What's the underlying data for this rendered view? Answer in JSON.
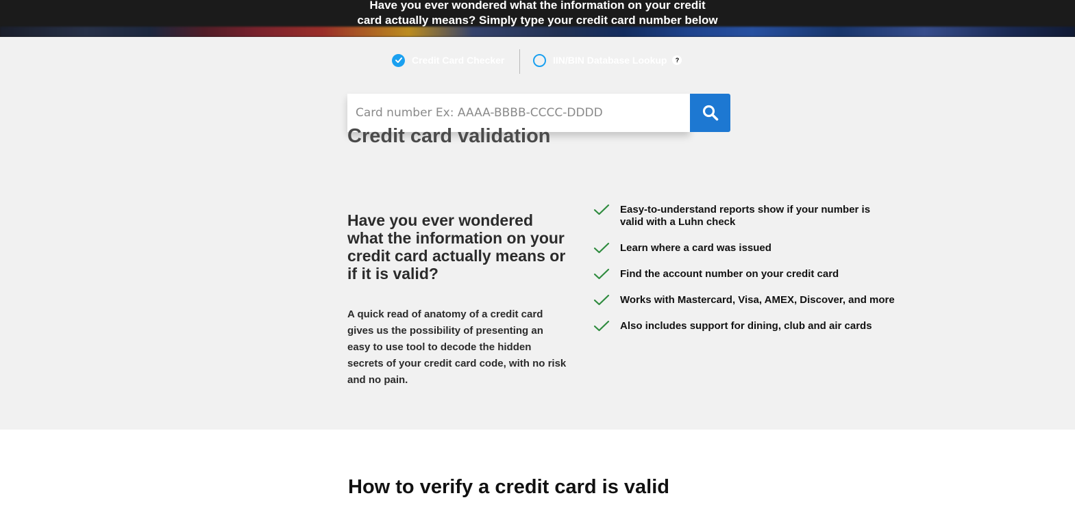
{
  "hero": {
    "line1": "Have you ever wondered what the information on your credit",
    "line2": "card actually means? Simply type your credit card number below"
  },
  "mode_toggle": {
    "options": [
      {
        "label": "Credit Card Checker",
        "selected": true
      },
      {
        "label": "IIN/BIN Database Lookup",
        "selected": false
      }
    ],
    "help_label": "?"
  },
  "search": {
    "placeholder": "Card number Ex: AAAA-BBBB-CCCC-DDDD",
    "value": "",
    "button_icon": "search-icon"
  },
  "section_title": "Credit card validation",
  "intro": {
    "heading": "Have you ever wondered what the information on your credit card actually means or if it is valid?",
    "body": "A quick read of anatomy of a credit card gives us the possibility of presenting an easy to use tool to decode the hidden secrets of your credit card code, with no risk and no pain."
  },
  "features": [
    "Easy-to-understand reports show if your number is valid with a Luhn check",
    "Learn where a card was issued",
    "Find the account number on your credit card",
    "Works with Mastercard, Visa, AMEX, Discover, and more",
    "Also includes support for dining, club and air cards"
  ],
  "bottom_title": "How to verify a credit card is valid",
  "colors": {
    "accent_blue": "#1d78d2",
    "radio_blue": "#1aa0f0",
    "check_green": "#2e8b3e",
    "section_bg": "#f1f1f1",
    "hero_bg": "#1b1b1b"
  }
}
